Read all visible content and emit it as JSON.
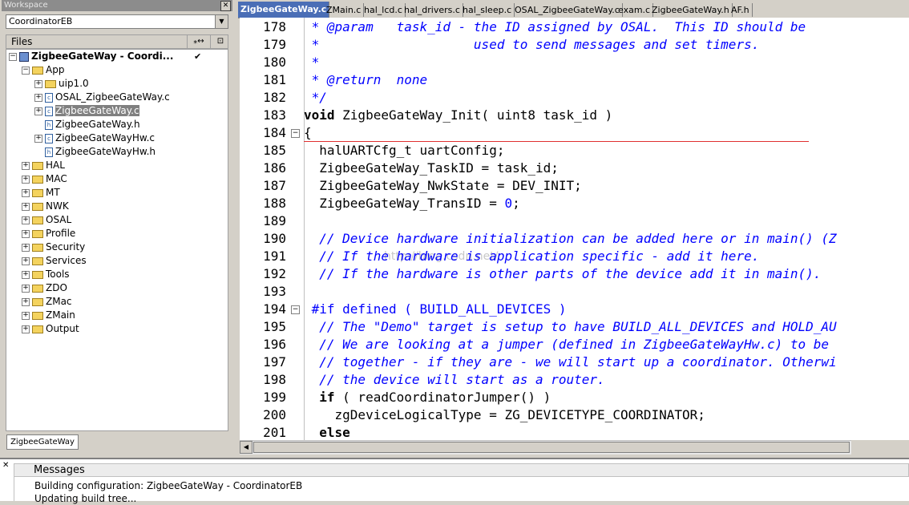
{
  "workspace": {
    "title": "Workspace",
    "config": "CoordinatorEB",
    "files_label": "Files",
    "col1": "⁎↔",
    "col2": "⊡",
    "tab": "ZigbeeGateWay",
    "tree": [
      {
        "label": "ZigbeeGateWay - Coordi...",
        "type": "project",
        "indent": 0,
        "expander": "−",
        "bold": true,
        "check": "✔"
      },
      {
        "label": "App",
        "type": "folder",
        "indent": 1,
        "expander": "−"
      },
      {
        "label": "uip1.0",
        "type": "folder",
        "indent": 2,
        "expander": "+"
      },
      {
        "label": "OSAL_ZigbeeGateWay.c",
        "type": "file",
        "indent": 2,
        "expander": "+"
      },
      {
        "label": "ZigbeeGateWay.c",
        "type": "file",
        "indent": 2,
        "expander": "+",
        "selected": true
      },
      {
        "label": "ZigbeeGateWay.h",
        "type": "file",
        "indent": 2,
        "expander": ""
      },
      {
        "label": "ZigbeeGateWayHw.c",
        "type": "file",
        "indent": 2,
        "expander": "+"
      },
      {
        "label": "ZigbeeGateWayHw.h",
        "type": "file",
        "indent": 2,
        "expander": ""
      },
      {
        "label": "HAL",
        "type": "folder",
        "indent": 1,
        "expander": "+"
      },
      {
        "label": "MAC",
        "type": "folder",
        "indent": 1,
        "expander": "+"
      },
      {
        "label": "MT",
        "type": "folder",
        "indent": 1,
        "expander": "+"
      },
      {
        "label": "NWK",
        "type": "folder",
        "indent": 1,
        "expander": "+"
      },
      {
        "label": "OSAL",
        "type": "folder",
        "indent": 1,
        "expander": "+"
      },
      {
        "label": "Profile",
        "type": "folder",
        "indent": 1,
        "expander": "+"
      },
      {
        "label": "Security",
        "type": "folder",
        "indent": 1,
        "expander": "+"
      },
      {
        "label": "Services",
        "type": "folder",
        "indent": 1,
        "expander": "+"
      },
      {
        "label": "Tools",
        "type": "folder",
        "indent": 1,
        "expander": "+"
      },
      {
        "label": "ZDO",
        "type": "folder",
        "indent": 1,
        "expander": "+"
      },
      {
        "label": "ZMac",
        "type": "folder",
        "indent": 1,
        "expander": "+"
      },
      {
        "label": "ZMain",
        "type": "folder",
        "indent": 1,
        "expander": "+"
      },
      {
        "label": "Output",
        "type": "folder",
        "indent": 1,
        "expander": "+"
      }
    ]
  },
  "editor": {
    "tabs": [
      {
        "label": "ZigbeeGateWay.c",
        "active": true
      },
      {
        "label": "ZMain.c"
      },
      {
        "label": "hal_lcd.c"
      },
      {
        "label": "hal_drivers.c"
      },
      {
        "label": "hal_sleep.c"
      },
      {
        "label": "OSAL_ZigbeeGateWay.c"
      },
      {
        "label": "exam.c"
      },
      {
        "label": "ZigbeeGateWay.h"
      },
      {
        "label": "AF.h"
      }
    ],
    "watermark": "http://blog.csdn.net/",
    "lines": [
      {
        "n": "178",
        "fold": "",
        "segs": [
          {
            "t": " * @param   task_id - the ID assigned by OSAL.  This ID should be",
            "c": "cm"
          }
        ]
      },
      {
        "n": "179",
        "fold": "",
        "segs": [
          {
            "t": " *                    used to send messages and set timers.",
            "c": "cm"
          }
        ]
      },
      {
        "n": "180",
        "fold": "",
        "segs": [
          {
            "t": " *",
            "c": "cm"
          }
        ]
      },
      {
        "n": "181",
        "fold": "",
        "segs": [
          {
            "t": " * @return  none",
            "c": "cm"
          }
        ]
      },
      {
        "n": "182",
        "fold": "",
        "segs": [
          {
            "t": " */",
            "c": "cm"
          }
        ]
      },
      {
        "n": "183",
        "fold": "",
        "segs": [
          {
            "t": "void",
            "c": "kw"
          },
          {
            "t": " ZigbeeGateWay_Init( uint8 task_id )",
            "c": ""
          }
        ]
      },
      {
        "n": "184",
        "fold": "−",
        "segs": [
          {
            "t": "{",
            "c": ""
          }
        ]
      },
      {
        "n": "185",
        "fold": "",
        "segs": [
          {
            "t": "  halUARTCfg_t uartConfig;",
            "c": ""
          }
        ]
      },
      {
        "n": "186",
        "fold": "",
        "segs": [
          {
            "t": "  ZigbeeGateWay_TaskID = task_id;",
            "c": ""
          }
        ]
      },
      {
        "n": "187",
        "fold": "",
        "segs": [
          {
            "t": "  ZigbeeGateWay_NwkState = DEV_INIT;",
            "c": ""
          }
        ]
      },
      {
        "n": "188",
        "fold": "",
        "segs": [
          {
            "t": "  ZigbeeGateWay_TransID = ",
            "c": ""
          },
          {
            "t": "0",
            "c": "num"
          },
          {
            "t": ";",
            "c": ""
          }
        ]
      },
      {
        "n": "189",
        "fold": "",
        "segs": []
      },
      {
        "n": "190",
        "fold": "",
        "segs": [
          {
            "t": "  // Device hardware initialization can be added here or in main() (Z",
            "c": "cm"
          }
        ]
      },
      {
        "n": "191",
        "fold": "",
        "segs": [
          {
            "t": "  // If the hardware is application specific - add it here.",
            "c": "cm"
          }
        ]
      },
      {
        "n": "192",
        "fold": "",
        "segs": [
          {
            "t": "  // If the hardware is other parts of the device add it in main().",
            "c": "cm"
          }
        ]
      },
      {
        "n": "193",
        "fold": "",
        "segs": []
      },
      {
        "n": "194",
        "fold": "−",
        "segs": [
          {
            "t": " #if defined ( BUILD_ALL_DEVICES )",
            "c": "mac"
          }
        ]
      },
      {
        "n": "195",
        "fold": "",
        "segs": [
          {
            "t": "  // The \"Demo\" target is setup to have BUILD_ALL_DEVICES and HOLD_AU",
            "c": "cm"
          }
        ]
      },
      {
        "n": "196",
        "fold": "",
        "segs": [
          {
            "t": "  // We are looking at a jumper (defined in ZigbeeGateWayHw.c) to be",
            "c": "cm"
          }
        ]
      },
      {
        "n": "197",
        "fold": "",
        "segs": [
          {
            "t": "  // together - if they are - we will start up a coordinator. Otherwi",
            "c": "cm"
          }
        ]
      },
      {
        "n": "198",
        "fold": "",
        "segs": [
          {
            "t": "  // the device will start as a router.",
            "c": "cm"
          }
        ]
      },
      {
        "n": "199",
        "fold": "",
        "segs": [
          {
            "t": "  ",
            "c": ""
          },
          {
            "t": "if",
            "c": "kw"
          },
          {
            "t": " ( readCoordinatorJumper() )",
            "c": ""
          }
        ]
      },
      {
        "n": "200",
        "fold": "",
        "segs": [
          {
            "t": "    zgDeviceLogicalType = ZG_DEVICETYPE_COORDINATOR;",
            "c": ""
          }
        ]
      },
      {
        "n": "201",
        "fold": "",
        "segs": [
          {
            "t": "  ",
            "c": ""
          },
          {
            "t": "else",
            "c": "kw"
          }
        ]
      }
    ]
  },
  "messages": {
    "close": "✕",
    "header": "Messages",
    "lines": [
      "Building configuration: ZigbeeGateWay - CoordinatorEB",
      "Updating build tree..."
    ]
  }
}
